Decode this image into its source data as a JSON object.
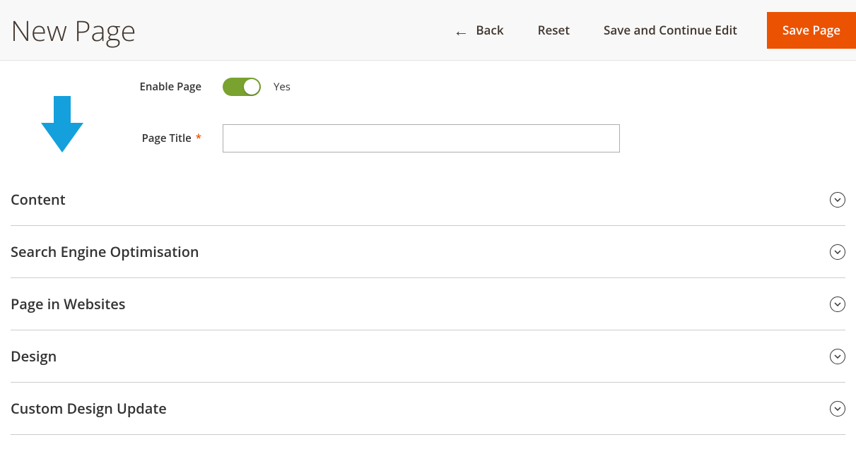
{
  "header": {
    "title": "New Page",
    "back": "Back",
    "reset": "Reset",
    "save_continue": "Save and Continue Edit",
    "save": "Save Page"
  },
  "form": {
    "enable_label": "Enable Page",
    "enable_value": "Yes",
    "title_label": "Page Title",
    "title_value": ""
  },
  "sections": [
    {
      "label": "Content"
    },
    {
      "label": "Search Engine Optimisation"
    },
    {
      "label": "Page in Websites"
    },
    {
      "label": "Design"
    },
    {
      "label": "Custom Design Update"
    }
  ],
  "colors": {
    "primary": "#eb5202",
    "toggle_on": "#79a22e",
    "annotation": "#0ea5e9"
  }
}
